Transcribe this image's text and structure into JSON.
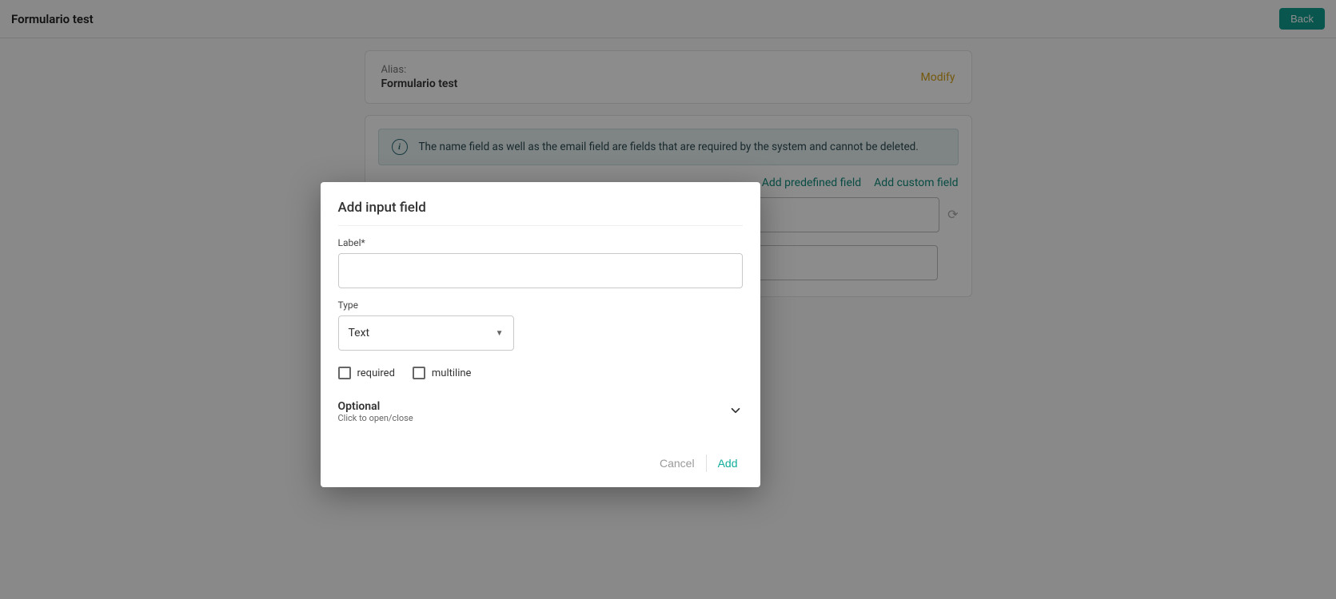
{
  "header": {
    "title": "Formulario test",
    "back_label": "Back"
  },
  "alias_card": {
    "label": "Alias:",
    "value": "Formulario test",
    "modify_label": "Modify"
  },
  "fields_card": {
    "info_text": "The name field as well as the email field are fields that are required by the system and cannot be deleted.",
    "add_predefined_label": "Add predefined field",
    "add_custom_label": "Add custom field"
  },
  "modal": {
    "title": "Add input field",
    "label_field": "Label*",
    "label_value": "",
    "type_label": "Type",
    "type_value": "Text",
    "required_label": "required",
    "multiline_label": "multiline",
    "optional_title": "Optional",
    "optional_sub": "Click to open/close",
    "cancel_label": "Cancel",
    "add_label": "Add"
  }
}
